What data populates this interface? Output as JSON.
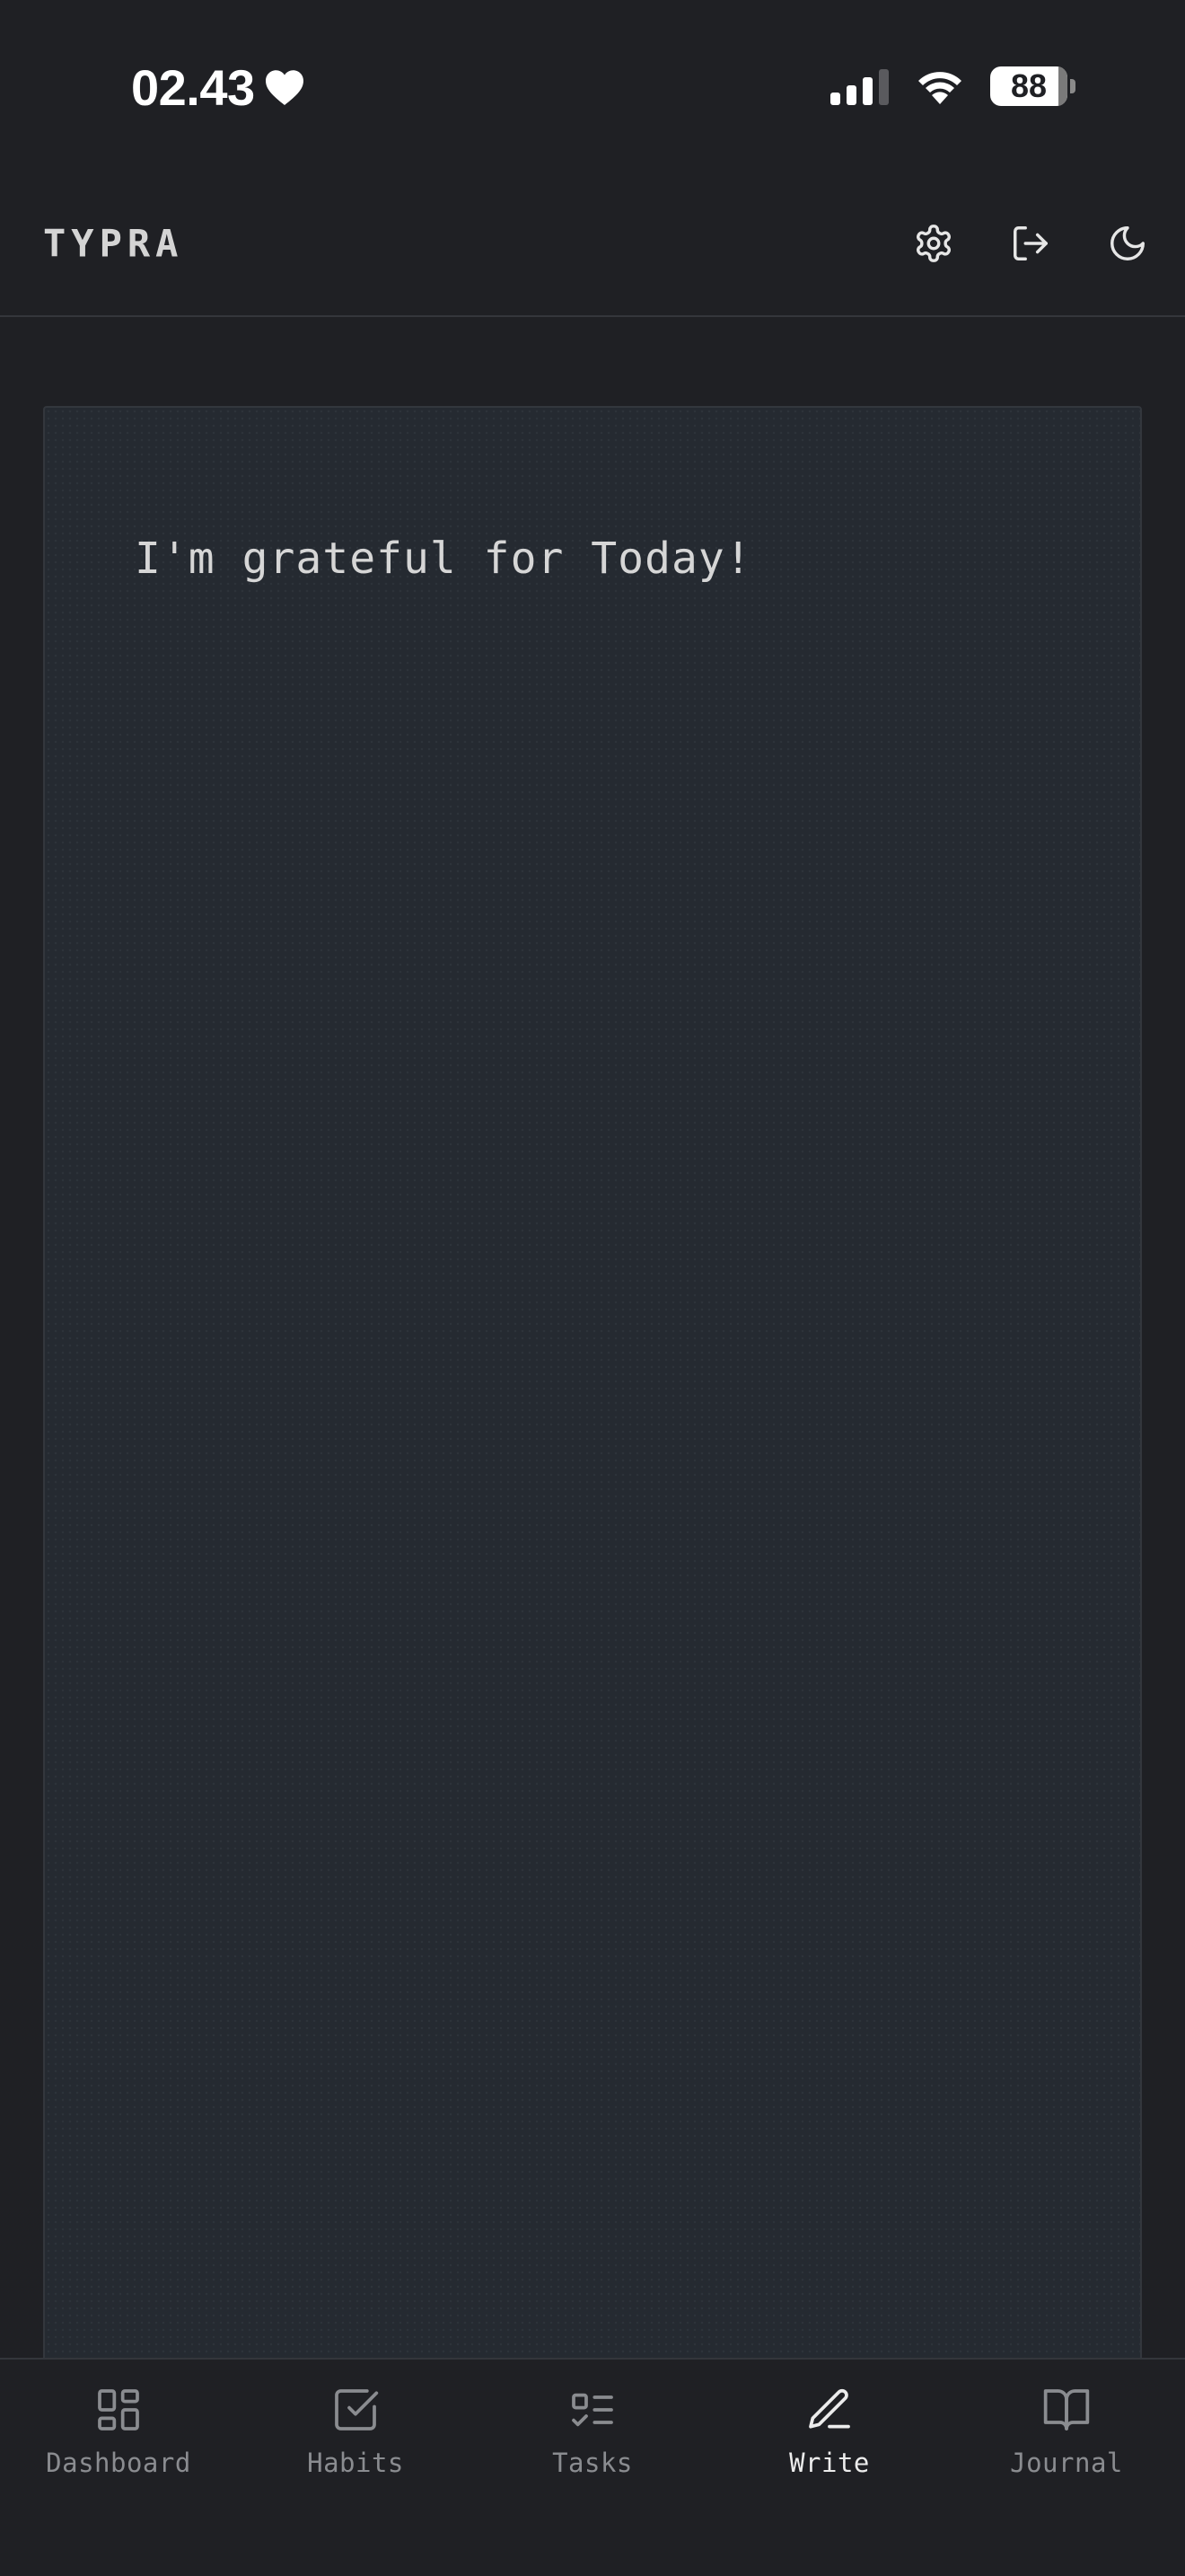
{
  "status_bar": {
    "time": "02.43",
    "battery": "88",
    "battery_level": 0.88,
    "icons": [
      "heart-icon",
      "signal-icon",
      "wifi-icon",
      "battery-icon"
    ]
  },
  "header": {
    "brand": "TYPRA",
    "actions": [
      "gear-icon",
      "logout-icon",
      "moon-icon"
    ]
  },
  "editor": {
    "content": "I'm grateful for Today!"
  },
  "nav": {
    "active": "Write",
    "items": [
      {
        "label": "Dashboard",
        "icon": "dashboard-icon"
      },
      {
        "label": "Habits",
        "icon": "check-square-icon"
      },
      {
        "label": "Tasks",
        "icon": "task-list-icon"
      },
      {
        "label": "Write",
        "icon": "pen-icon"
      },
      {
        "label": "Journal",
        "icon": "book-open-icon"
      }
    ]
  },
  "colors": {
    "background": "#1f2024",
    "editor_background": "#252a31",
    "text": "#d6d6d6",
    "nav_inactive": "#8a8c90",
    "nav_active": "#ececec"
  }
}
